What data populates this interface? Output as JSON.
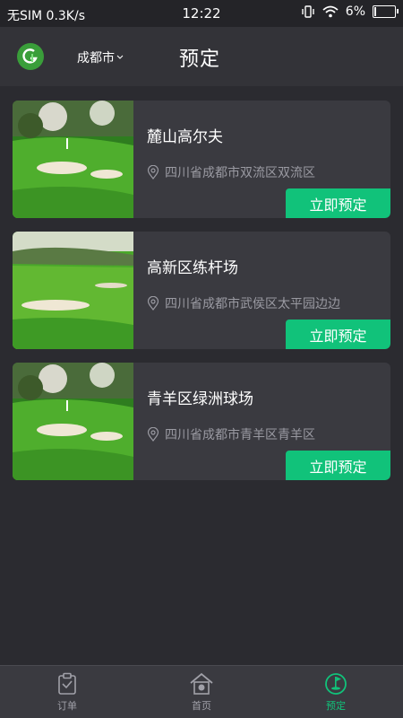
{
  "status": {
    "carrier": "无SIM 0.3K/s",
    "time": "12:22",
    "battery": "6%"
  },
  "header": {
    "city": "成都市",
    "title": "预定"
  },
  "courses": [
    {
      "name": "麓山高尔夫",
      "address": "四川省成都市双流区双流区",
      "button": "立即预定"
    },
    {
      "name": "高新区练杆场",
      "address": "四川省成都市武侯区太平园边边",
      "button": "立即预定"
    },
    {
      "name": "青羊区绿洲球场",
      "address": "四川省成都市青羊区青羊区",
      "button": "立即预定"
    }
  ],
  "tabs": [
    {
      "label": "订单",
      "icon": "clipboard-icon"
    },
    {
      "label": "首页",
      "icon": "home-icon"
    },
    {
      "label": "预定",
      "icon": "golf-booking-icon"
    }
  ],
  "colors": {
    "accent": "#11c27a",
    "background": "#2b2b30"
  }
}
